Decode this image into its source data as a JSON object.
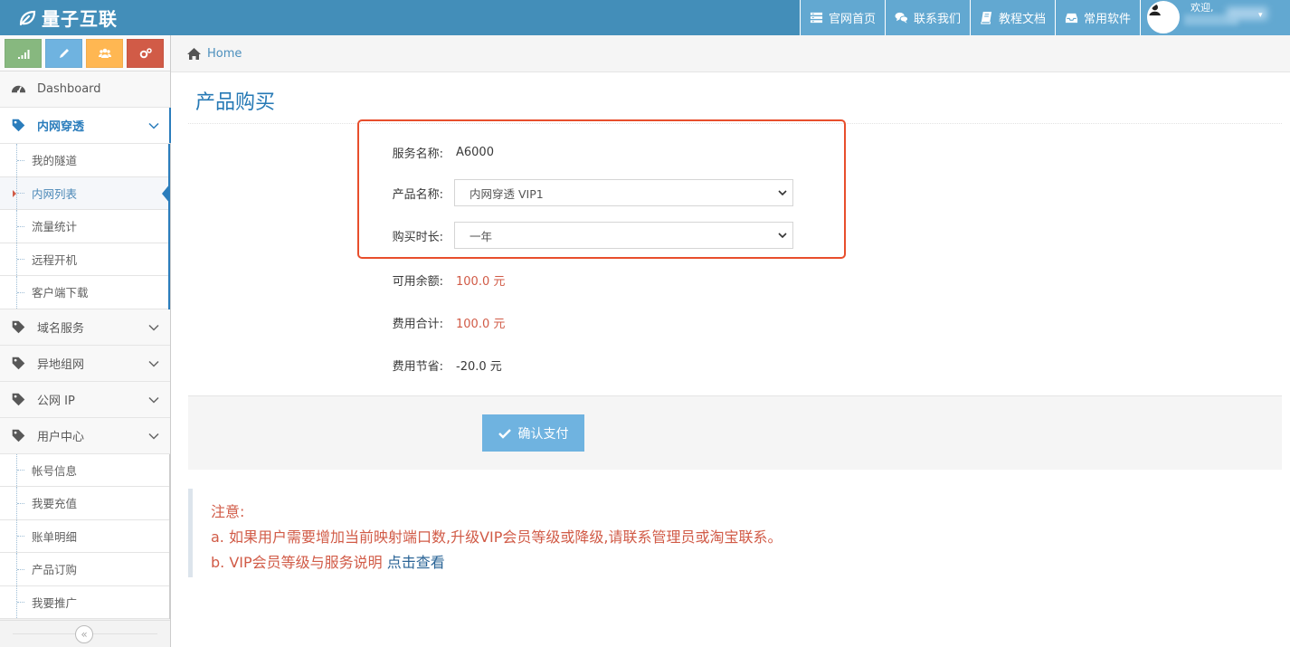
{
  "brand": {
    "name": "量子互联"
  },
  "topnav": {
    "items": [
      {
        "label": "官网首页",
        "icon": "list-icon"
      },
      {
        "label": "联系我们",
        "icon": "chat-icon"
      },
      {
        "label": "教程文档",
        "icon": "book-icon"
      },
      {
        "label": "常用软件",
        "icon": "inbox-icon"
      }
    ],
    "user": {
      "welcome": "欢迎,"
    }
  },
  "shortcuts": [
    {
      "icon": "signal-icon",
      "color": "#87b87f"
    },
    {
      "icon": "pencil-icon",
      "color": "#6fb3e0"
    },
    {
      "icon": "users-icon",
      "color": "#ffb752"
    },
    {
      "icon": "cogs-icon",
      "color": "#d15b47"
    }
  ],
  "sidebar": {
    "dashboard": "Dashboard",
    "groups": [
      {
        "label": "内网穿透",
        "active": true,
        "items": [
          "我的隧道",
          "内网列表",
          "流量统计",
          "远程开机",
          "客户端下载"
        ],
        "active_item": "内网列表"
      },
      {
        "label": "域名服务"
      },
      {
        "label": "异地组网"
      },
      {
        "label": "公网 IP"
      },
      {
        "label": "用户中心",
        "items": [
          "帐号信息",
          "我要充值",
          "账单明细",
          "产品订购",
          "我要推广"
        ]
      }
    ]
  },
  "breadcrumb": {
    "home": "Home"
  },
  "page": {
    "title": "产品购买"
  },
  "form": {
    "service_name_label": "服务名称:",
    "service_name_value": "A6000",
    "product_label": "产品名称:",
    "product_selected": "内网穿透 VIP1",
    "duration_label": "购买时长:",
    "duration_selected": "一年",
    "balance_label": "可用余额:",
    "balance_value": "100.0 元",
    "total_label": "费用合计:",
    "total_value": "100.0 元",
    "savings_label": "费用节省:",
    "savings_value": "-20.0 元",
    "pay_button": "确认支付"
  },
  "notice": {
    "title": "注意:",
    "line_a": "a. 如果用户需要增加当前映射端口数,升级VIP会员等级或降级,请联系管理员或淘宝联系。",
    "line_b_text": "b. VIP会员等级与服务说明 ",
    "line_b_link": "点击查看"
  },
  "colors": {
    "navbar": "#438eb9",
    "accent": "#2679b5",
    "notice_red": "#d15b47",
    "highlight": "#e84e2c"
  }
}
